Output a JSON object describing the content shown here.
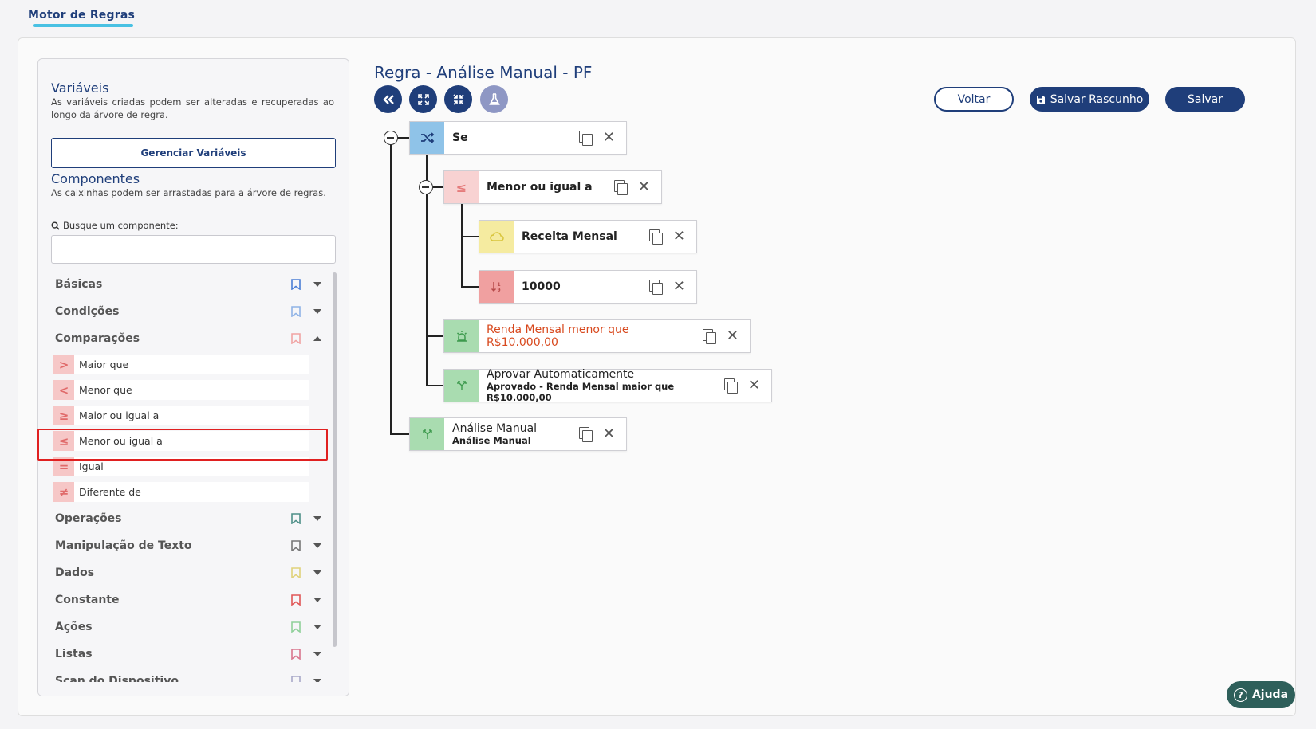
{
  "app": {
    "tab_label": "Motor de Regras"
  },
  "sidebar": {
    "variables_title": "Variáveis",
    "variables_desc": "As variáveis criadas podem ser alteradas e recuperadas ao longo da árvore de regra.",
    "manage_button": "Gerenciar Variáveis",
    "components_title": "Componentes",
    "components_desc": "As caixinhas podem ser arrastadas para a árvore de regras.",
    "search_label": "Busque um componente:",
    "search_placeholder": "",
    "categories": [
      {
        "label": "Básicas",
        "bookmark_color": "#4b7fd6",
        "expanded": false
      },
      {
        "label": "Condições",
        "bookmark_color": "#8fb3e6",
        "expanded": false
      },
      {
        "label": "Comparações",
        "bookmark_color": "#f0a3a3",
        "expanded": true
      },
      {
        "label": "Operações",
        "bookmark_color": "#4e8f88",
        "expanded": false
      },
      {
        "label": "Manipulação de Texto",
        "bookmark_color": "#777777",
        "expanded": false
      },
      {
        "label": "Dados",
        "bookmark_color": "#e0d27a",
        "expanded": false
      },
      {
        "label": "Constante",
        "bookmark_color": "#e05757",
        "expanded": false
      },
      {
        "label": "Ações",
        "bookmark_color": "#8fd09a",
        "expanded": false
      },
      {
        "label": "Listas",
        "bookmark_color": "#d9768e",
        "expanded": false
      },
      {
        "label": "Scan do Dispositivo",
        "bookmark_color": "#a8a8c8",
        "expanded": false
      }
    ],
    "comparisons": [
      {
        "label": "Maior que",
        "symbol": ">"
      },
      {
        "label": "Menor que",
        "symbol": "<"
      },
      {
        "label": "Maior ou igual a",
        "symbol": "≥"
      },
      {
        "label": "Menor ou igual a",
        "symbol": "≤"
      },
      {
        "label": "Igual",
        "symbol": "="
      },
      {
        "label": "Diferente de",
        "symbol": "≠"
      }
    ]
  },
  "rule": {
    "title": "Regra - Análise Manual - PF",
    "toolbar_icons": [
      "double-chevron-left-icon",
      "expand-icon",
      "compress-icon",
      "flask-icon"
    ],
    "buttons": {
      "back": "Voltar",
      "save_draft": "Salvar Rascunho",
      "save": "Salvar"
    }
  },
  "tree": {
    "if_node": {
      "label": "Se",
      "icon": "shuffle-icon",
      "color": "#8fc3e8"
    },
    "lte_node": {
      "label": "Menor ou igual a",
      "icon": "lte-icon",
      "color": "#f8d2d2"
    },
    "var_node": {
      "label": "Receita Mensal",
      "icon": "cloud-icon",
      "color": "#f5eba0"
    },
    "const_node": {
      "label": "10000",
      "icon": "sort-numeric-icon",
      "color": "#f0a0a0"
    },
    "alarm_node": {
      "label": "Renda Mensal menor que R$10.000,00",
      "icon": "alarm-icon",
      "color": "#a9dcb0"
    },
    "approve_node": {
      "label": "Aprovar Automaticamente",
      "sublabel": "Aprovado - Renda Mensal maior que R$10.000,00",
      "icon": "fork-icon",
      "color": "#a9dcb0"
    },
    "manual_node": {
      "label": "Análise Manual",
      "sublabel": "Análise Manual",
      "icon": "fork-icon",
      "color": "#a9dcb0"
    }
  },
  "help": {
    "label": "Ajuda"
  },
  "colors": {
    "brand": "#1f3e7a",
    "accent": "#49c1e3",
    "danger": "#e02020"
  }
}
